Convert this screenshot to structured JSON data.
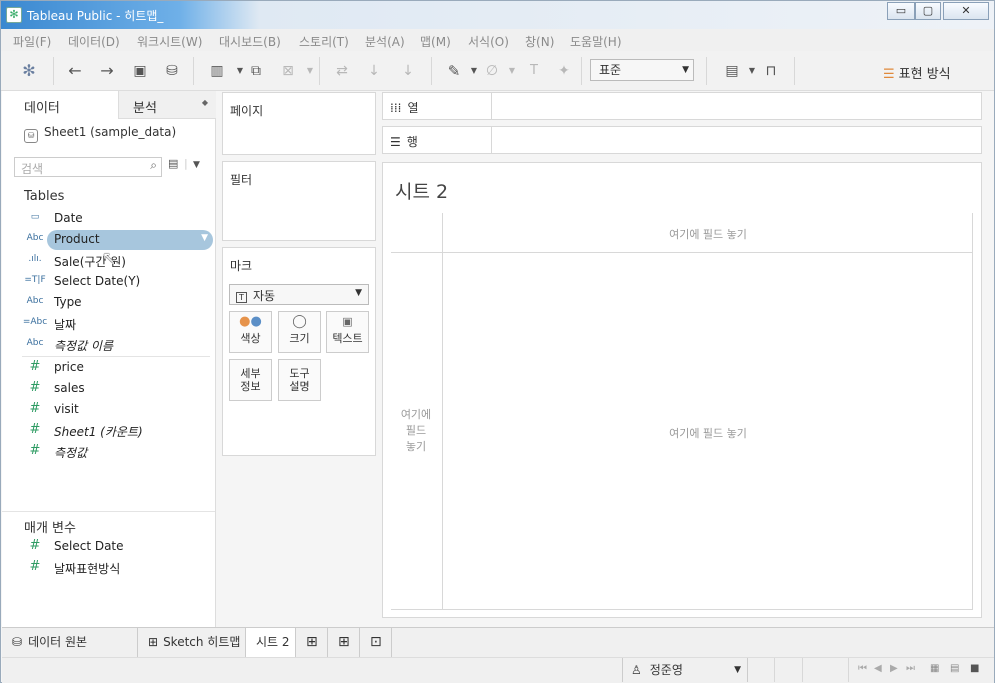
{
  "window": {
    "title": "Tableau Public - 히트맵_",
    "minimize_label": "▭",
    "maximize_label": "▢",
    "close_label": "✕"
  },
  "menu": [
    "파일(F)",
    "데이터(D)",
    "워크시트(W)",
    "대시보드(B)",
    "스토리(T)",
    "분석(A)",
    "맵(M)",
    "서식(O)",
    "창(N)",
    "도움말(H)"
  ],
  "toolbar": {
    "fit_select_value": "표준",
    "show_me_label": "표현 방식"
  },
  "data_pane": {
    "tab_data": "데이터",
    "tab_analysis": "분석",
    "source_name": "Sheet1 (sample_data)",
    "search_placeholder": "검색",
    "tables_heading": "Tables",
    "dimensions": [
      {
        "icon": "date",
        "name": "Date"
      },
      {
        "icon": "Abc",
        "name": "Product"
      },
      {
        "icon": "bin",
        "name": "Sale(구간 원)"
      },
      {
        "icon": "=T|F",
        "name": "Select Date(Y)"
      },
      {
        "icon": "Abc",
        "name": "Type"
      },
      {
        "icon": "=Abc",
        "name": "날짜"
      },
      {
        "icon": "Abc",
        "name": "측정값 이름"
      }
    ],
    "measures": [
      {
        "name": "price"
      },
      {
        "name": "sales"
      },
      {
        "name": "visit"
      },
      {
        "name": "Sheet1 (카운트)"
      },
      {
        "name": "측정값"
      }
    ],
    "parameters_heading": "매개 변수",
    "parameters": [
      {
        "name": "Select Date"
      },
      {
        "name": "날짜표현방식"
      }
    ]
  },
  "cards": {
    "pages": "페이지",
    "filters": "필터",
    "marks": "마크",
    "mark_type": "자동",
    "mark_buttons": [
      {
        "label": "색상",
        "icon": "color-icon"
      },
      {
        "label": "크기",
        "icon": "size-icon"
      },
      {
        "label": "텍스트",
        "icon": "text-icon"
      },
      {
        "label": "세부\n정보",
        "icon": "detail-icon"
      },
      {
        "label": "도구\n설명",
        "icon": "tooltip-icon"
      }
    ]
  },
  "shelves": {
    "columns_label": "열",
    "rows_label": "행"
  },
  "view": {
    "title": "시트 2",
    "drop_top": "여기에 필드 놓기",
    "drop_left": "여기에\n필드\n놓기",
    "drop_center": "여기에 필드 놓기"
  },
  "sheet_tabs": {
    "data_source": "데이터 원본",
    "sheets": [
      "Sketch 히트맵",
      "시트 2"
    ],
    "active": "시트 2"
  },
  "status": {
    "user": "정준영"
  }
}
